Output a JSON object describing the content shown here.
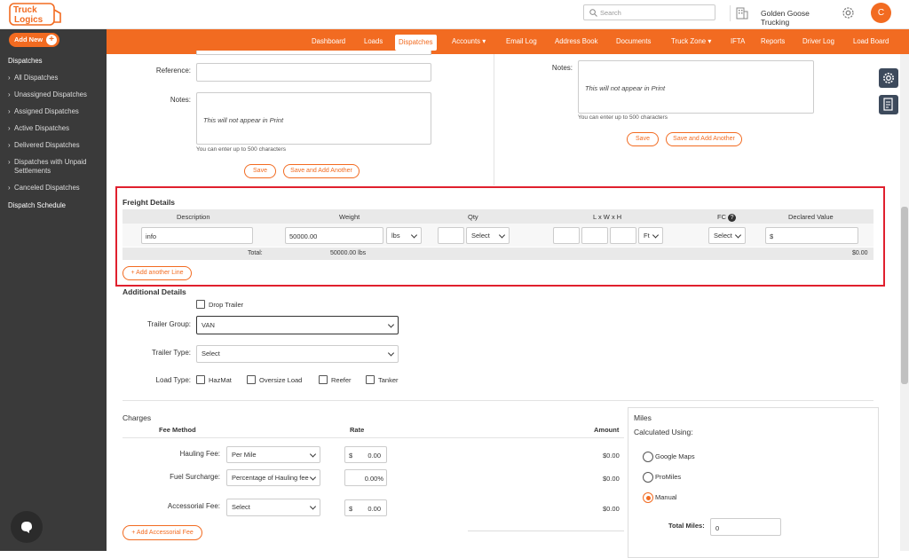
{
  "app": {
    "logo_line1": "Truck",
    "logo_line2": "Logics"
  },
  "header": {
    "search_placeholder": "Search",
    "company_name": "Golden Goose Trucking",
    "avatar_initial": "C"
  },
  "nav": {
    "add_new": "Add New",
    "items": [
      "Dashboard",
      "Loads",
      "Dispatches",
      "Accounts",
      "Email Log",
      "Address Book",
      "Documents",
      "Truck Zone",
      "IFTA",
      "Reports",
      "Driver Log",
      "Load Board"
    ],
    "active": "Dispatches"
  },
  "sidebar": {
    "section": "Dispatches",
    "items": [
      "All Dispatches",
      "Unassigned Dispatches",
      "Assigned Dispatches",
      "Active Dispatches",
      "Delivered Dispatches",
      "Dispatches with Unpaid",
      "Settlements",
      "Canceled Dispatches"
    ],
    "footer": "Dispatch Schedule"
  },
  "left_form": {
    "reference_label": "Reference:",
    "notes_label": "Notes:",
    "notes_placeholder": "This will not appear in Print",
    "hint": "You can enter up to 500 characters",
    "save": "Save",
    "save_add": "Save and Add Another"
  },
  "right_form": {
    "notes_label": "Notes:",
    "notes_placeholder": "This will not appear in Print",
    "hint": "You can enter up to 500 characters",
    "save": "Save",
    "save_add": "Save and Add Another"
  },
  "freight": {
    "title": "Freight Details",
    "columns": [
      "Description",
      "Weight",
      "Qty",
      "L x W x H",
      "FC",
      "Declared Value"
    ],
    "row": {
      "description": "info",
      "weight": "50000.00",
      "weight_unit": "lbs",
      "qty_unit": "Select",
      "dim_unit": "Ft",
      "fc": "Select",
      "declared_prefix": "$"
    },
    "total_label": "Total:",
    "total_weight": "50000.00 lbs",
    "total_value": "$0.00",
    "add_line": "Add another Line"
  },
  "additional": {
    "title": "Additional Details",
    "drop_trailer": "Drop Trailer",
    "trailer_group_label": "Trailer Group:",
    "trailer_group_value": "VAN",
    "trailer_type_label": "Trailer Type:",
    "trailer_type_value": "Select",
    "load_type_label": "Load Type:",
    "load_types": [
      "HazMat",
      "Oversize Load",
      "Reefer",
      "Tanker"
    ]
  },
  "charges": {
    "title": "Charges",
    "col_fee": "Fee Method",
    "col_rate": "Rate",
    "col_amount": "Amount",
    "rows": [
      {
        "label": "Hauling Fee:",
        "method": "Per Mile",
        "rate_prefix": "$",
        "rate": "0.00",
        "amount": "$0.00"
      },
      {
        "label": "Fuel Surcharge:",
        "method": "Percentage of Hauling fee",
        "rate_prefix": "",
        "rate": "0.00%",
        "amount": "$0.00"
      },
      {
        "label": "Accessorial Fee:",
        "method": "Select",
        "rate_prefix": "$",
        "rate": "0.00",
        "amount": "$0.00"
      }
    ],
    "add_accessorial": "Add Accessorial Fee"
  },
  "miles": {
    "title": "Miles",
    "calc_label": "Calculated Using:",
    "options": [
      "Google Maps",
      "ProMiles",
      "Manual"
    ],
    "selected": "Manual",
    "total_label": "Total Miles:",
    "total_value": "0"
  },
  "colors": {
    "brand": "#f26b21",
    "highlight": "#e0202e",
    "sidebar": "#3a3a3a"
  }
}
